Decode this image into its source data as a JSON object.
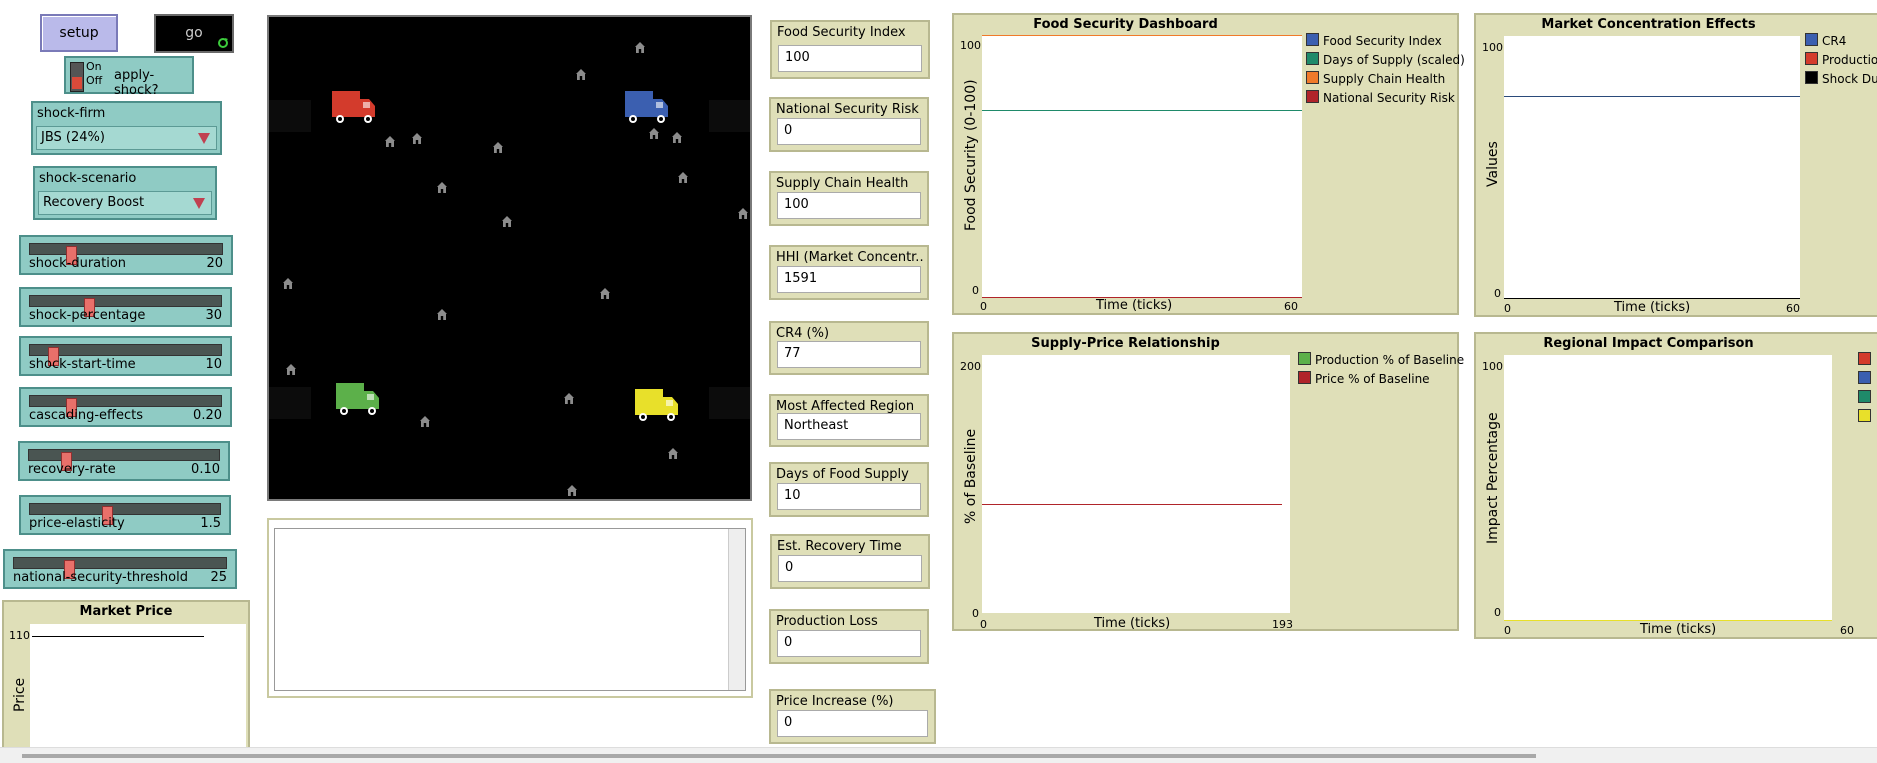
{
  "buttons": {
    "setup": "setup",
    "go": "go"
  },
  "switch": {
    "on": "On",
    "off": "Off",
    "name": "apply-shock?"
  },
  "choosers": {
    "shock_firm": {
      "label": "shock-firm",
      "value": "JBS (24%)"
    },
    "shock_scenario": {
      "label": "shock-scenario",
      "value": "Recovery Boost"
    }
  },
  "sliders": {
    "shock_duration": {
      "name": "shock-duration",
      "value": "20",
      "fraction": 0.2
    },
    "shock_percentage": {
      "name": "shock-percentage",
      "value": "30",
      "fraction": 0.3
    },
    "shock_start_time": {
      "name": "shock-start-time",
      "value": "10",
      "fraction": 0.1
    },
    "cascading_effects": {
      "name": "cascading-effects",
      "value": "0.20",
      "fraction": 0.2
    },
    "recovery_rate": {
      "name": "recovery-rate",
      "value": "0.10",
      "fraction": 0.18
    },
    "price_elasticity": {
      "name": "price-elasticity",
      "value": "1.5",
      "fraction": 0.4
    },
    "national_security_threshold": {
      "name": "national-security-threshold",
      "value": "25",
      "fraction": 0.25
    }
  },
  "monitors": {
    "food_security_index": {
      "label": "Food Security Index",
      "value": "100"
    },
    "national_security_risk": {
      "label": "National Security Risk",
      "value": "0"
    },
    "supply_chain_health": {
      "label": "Supply Chain Health",
      "value": "100"
    },
    "hhi": {
      "label": "HHI (Market Concentr...",
      "value": "1591"
    },
    "cr4": {
      "label": "CR4 (%)",
      "value": "77"
    },
    "most_affected_region": {
      "label": "Most Affected Region",
      "value": "Northeast"
    },
    "days_of_food_supply": {
      "label": "Days of Food Supply",
      "value": "10"
    },
    "est_recovery_time": {
      "label": "Est. Recovery Time",
      "value": "0"
    },
    "production_loss": {
      "label": "Production Loss",
      "value": "0"
    },
    "price_increase": {
      "label": "Price Increase (%)",
      "value": "0"
    }
  },
  "colors": {
    "red": "#d33b2c",
    "blue": "#3b5fb0",
    "green": "#5cb04a",
    "yellow": "#e8e02a",
    "dark_green": "#1f8a6a",
    "orange": "#f07a2a",
    "dark_red": "#b0242a",
    "interface": "#8fcbc4",
    "plot_bg": "#dfdfb8"
  },
  "plots": {
    "market_price": {
      "title": "Market Price",
      "ylabel": "Price",
      "ymax": "110"
    },
    "food_security_dashboard": {
      "title": "Food Security Dashboard",
      "ylabel": "Food Security (0-100)",
      "xlabel": "Time (ticks)",
      "xmin": "0",
      "xmax": "60",
      "ymin": "0",
      "ymax": "100",
      "legend": [
        "Food Security Index",
        "Days of Supply (scaled)",
        "Supply Chain Health",
        "National Security Risk"
      ]
    },
    "market_concentration": {
      "title": "Market Concentration Effects",
      "ylabel": "Values",
      "xlabel": "Time (ticks)",
      "xmin": "0",
      "xmax": "60",
      "ymin": "0",
      "ymax": "100",
      "legend": [
        "CR4",
        "Productio",
        "Shock Du"
      ]
    },
    "supply_price": {
      "title": "Supply-Price Relationship",
      "ylabel": "% of Baseline",
      "xlabel": "Time (ticks)",
      "xmin": "0",
      "xmax": "193",
      "ymin": "0",
      "ymax": "200",
      "legend": [
        "Production % of Baseline",
        "Price % of Baseline"
      ]
    },
    "regional_impact": {
      "title": "Regional Impact Comparison",
      "ylabel": "Impact Percentage",
      "xlabel": "Time (ticks)",
      "xmin": "0",
      "xmax": "60",
      "ymin": "0",
      "ymax": "100"
    }
  },
  "chart_data": [
    {
      "type": "line",
      "title": "Food Security Dashboard",
      "xlabel": "Time (ticks)",
      "ylabel": "Food Security (0-100)",
      "xlim": [
        0,
        60
      ],
      "ylim": [
        0,
        100
      ],
      "series": [
        {
          "name": "Food Security Index",
          "value": 100
        },
        {
          "name": "Days of Supply (scaled)",
          "value": 71
        },
        {
          "name": "Supply Chain Health",
          "value": 100
        },
        {
          "name": "National Security Risk",
          "value": 0
        }
      ]
    },
    {
      "type": "line",
      "title": "Market Concentration Effects",
      "xlabel": "Time (ticks)",
      "ylabel": "Values",
      "xlim": [
        0,
        60
      ],
      "ylim": [
        0,
        100
      ],
      "series": [
        {
          "name": "CR4",
          "value": 77
        },
        {
          "name": "Productio",
          "value": 0
        }
      ]
    },
    {
      "type": "line",
      "title": "Supply-Price Relationship",
      "xlabel": "Time (ticks)",
      "ylabel": "% of Baseline",
      "xlim": [
        0,
        193
      ],
      "ylim": [
        0,
        200
      ],
      "series": [
        {
          "name": "Price % of Baseline",
          "value": 100
        }
      ]
    },
    {
      "type": "line",
      "title": "Regional Impact Comparison",
      "xlabel": "Time (ticks)",
      "ylabel": "Impact Percentage",
      "xlim": [
        0,
        60
      ],
      "ylim": [
        0,
        100
      ]
    },
    {
      "type": "line",
      "title": "Market Price",
      "ylabel": "Price",
      "series": [
        {
          "value": 110
        }
      ]
    }
  ],
  "world": {
    "trucks": [
      {
        "color": "red",
        "icon": "truck-icon"
      },
      {
        "color": "blue",
        "icon": "truck-icon"
      },
      {
        "color": "green",
        "icon": "truck-icon"
      },
      {
        "color": "yellow",
        "icon": "truck-icon"
      }
    ],
    "house_icon": "house-icon"
  }
}
